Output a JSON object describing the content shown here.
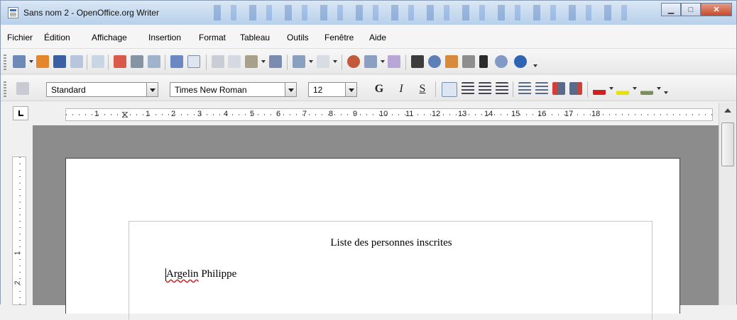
{
  "window": {
    "title": "Sans nom 2 - OpenOffice.org Writer",
    "controls": [
      "minimize",
      "maximize",
      "close"
    ]
  },
  "menu": {
    "items": [
      "Fichier",
      "Édition",
      "Affichage",
      "Insertion",
      "Format",
      "Tableau",
      "Outils",
      "Fenêtre",
      "Aide"
    ]
  },
  "toolbar_formatting": {
    "style_value": "Standard",
    "font_value": "Times New Roman",
    "size_value": "12",
    "bold_label": "G",
    "italic_label": "I",
    "underline_label": "S"
  },
  "ruler": {
    "numbers": [
      "1",
      "1",
      "2",
      "3",
      "4",
      "5",
      "6",
      "7",
      "8",
      "9",
      "10",
      "11",
      "12",
      "13",
      "14",
      "15",
      "16",
      "17",
      "18"
    ]
  },
  "vruler": {
    "numbers": [
      "1",
      "2"
    ]
  },
  "document": {
    "title": "Liste des personnes inscrites",
    "line1_first": "Argelin",
    "line1_rest": " Philippe"
  },
  "colors": {
    "page_background": "#8c8c8c",
    "spelling_underline": "#d02020",
    "title_bar": "#c9dcf0"
  },
  "icons": [
    "new-document-icon",
    "open-icon",
    "save-icon",
    "email-icon",
    "edit-file-icon",
    "export-pdf-icon",
    "print-icon",
    "page-preview-icon",
    "spellcheck-icon",
    "autospellcheck-icon",
    "cut-icon",
    "copy-icon",
    "paste-icon",
    "format-paintbrush-icon",
    "undo-icon",
    "redo-icon",
    "navigator-icon",
    "table-icon",
    "draw-functions-icon",
    "find-replace-icon",
    "gallery-icon",
    "data-sources-icon",
    "formatting-marks-icon",
    "zoom-icon",
    "help-icon"
  ]
}
